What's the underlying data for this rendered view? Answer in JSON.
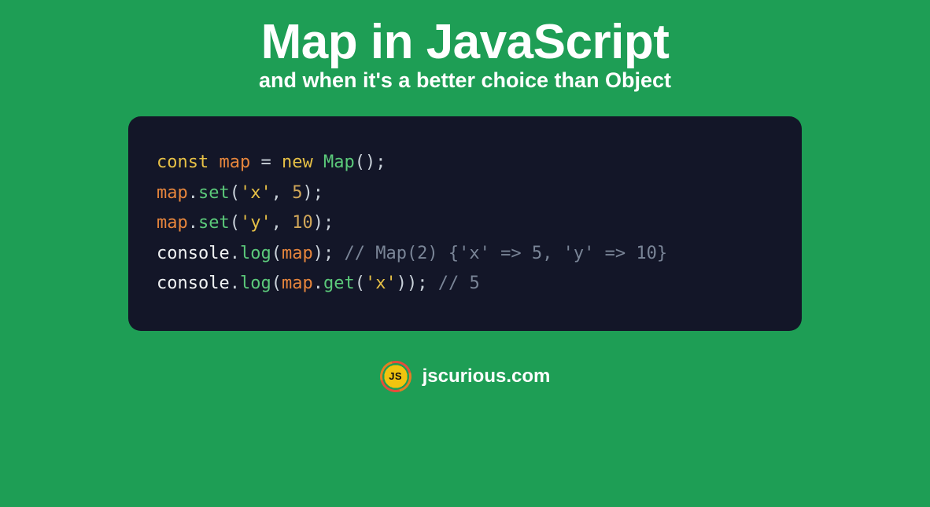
{
  "title": "Map in JavaScript",
  "subtitle": "and when it's a better choice than Object",
  "code": {
    "line1": {
      "const": "const",
      "map": "map",
      "eq": " = ",
      "new": "new",
      "Map": "Map",
      "parens": "();"
    },
    "line2": {
      "map": "map",
      "dot": ".",
      "set": "set",
      "open": "(",
      "str": "'x'",
      "comma": ", ",
      "num": "5",
      "close": ");"
    },
    "line3": {
      "map": "map",
      "dot": ".",
      "set": "set",
      "open": "(",
      "str": "'y'",
      "comma": ", ",
      "num": "10",
      "close": ");"
    },
    "line4": {
      "console": "console",
      "dot": ".",
      "log": "log",
      "open": "(",
      "map": "map",
      "close": "); ",
      "comment": "// Map(2) {'x' => 5, 'y' => 10}"
    },
    "line5": {
      "console": "console",
      "dot": ".",
      "log": "log",
      "open": "(",
      "map": "map",
      "dot2": ".",
      "get": "get",
      "open2": "(",
      "str": "'x'",
      "close2": ")",
      "close": "); ",
      "comment": "// 5"
    }
  },
  "logo_text": "JS",
  "site": "jscurious.com"
}
